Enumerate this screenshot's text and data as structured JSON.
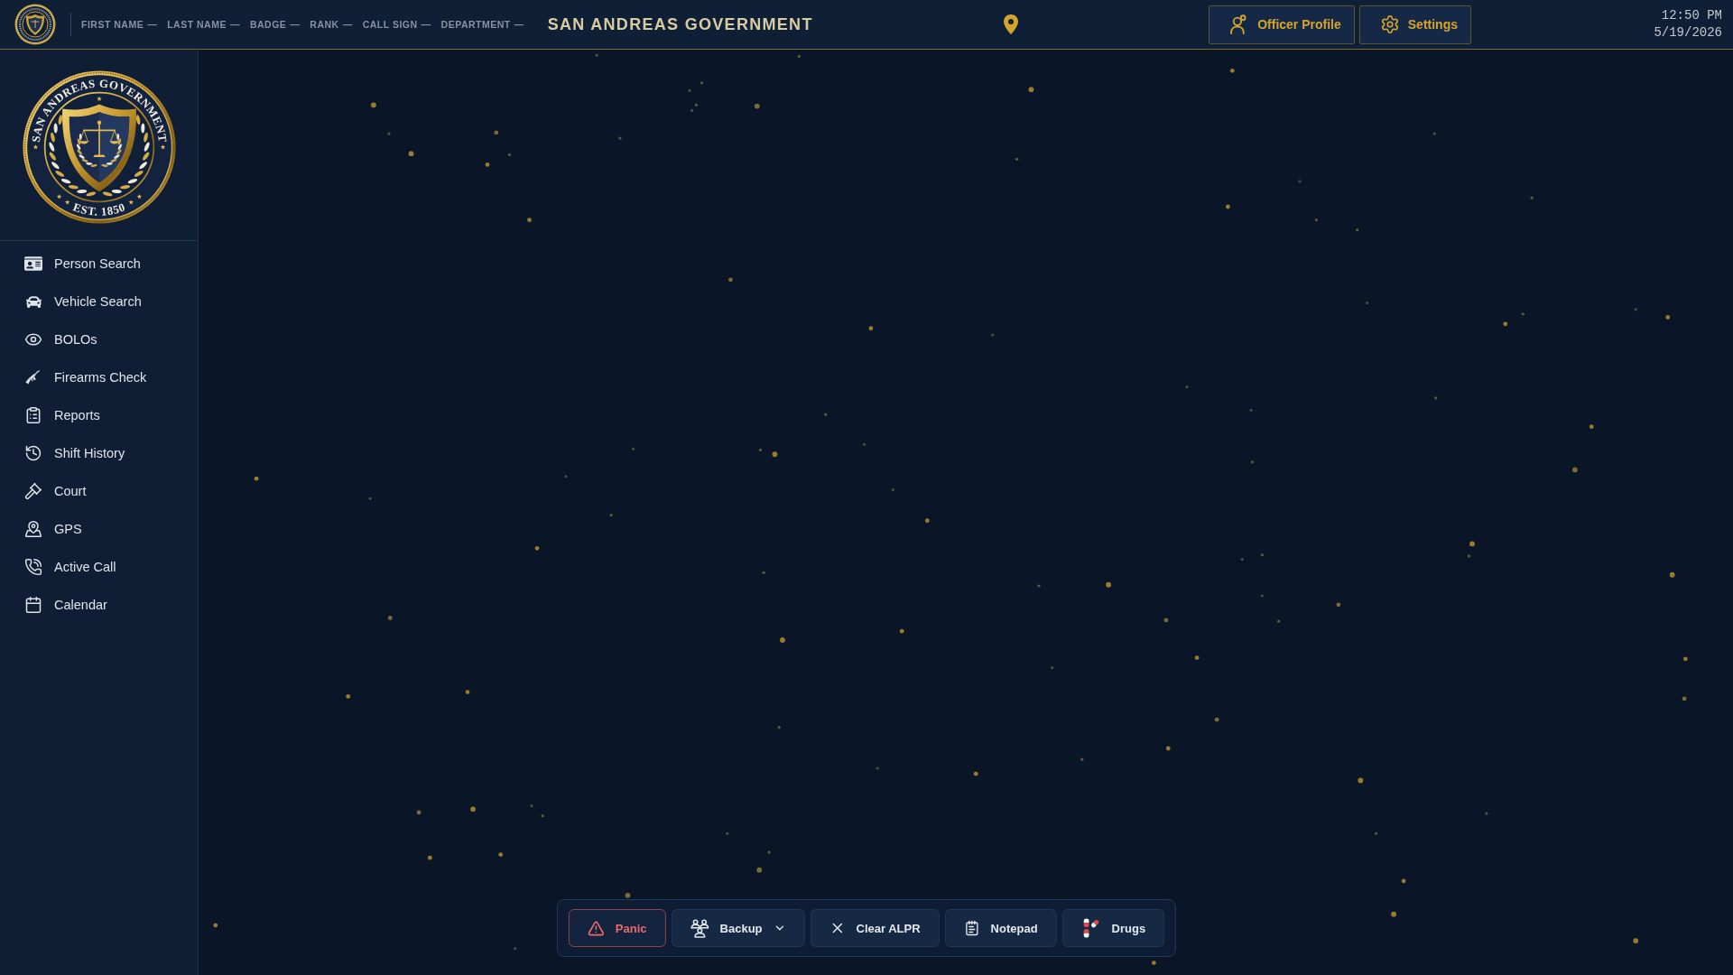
{
  "header": {
    "fields": [
      {
        "label": "FIRST NAME",
        "value": "—"
      },
      {
        "label": "LAST NAME",
        "value": "—"
      },
      {
        "label": "BADGE",
        "value": "—"
      },
      {
        "label": "RANK",
        "value": "—"
      },
      {
        "label": "CALL SIGN",
        "value": "—"
      },
      {
        "label": "DEPARTMENT",
        "value": "—"
      }
    ],
    "title": "SAN ANDREAS GOVERNMENT",
    "buttons": [
      "Officer Profile",
      "Settings"
    ],
    "time": "12:50 PM",
    "date": "5/19/2026"
  },
  "sidebar": {
    "seal": {
      "arc_text": "SAN ANDREAS GOVERNMENT",
      "year_text": "EST. 1850"
    },
    "items": [
      {
        "label": "Person Search",
        "selected": false
      },
      {
        "label": "Vehicle Search",
        "selected": false
      },
      {
        "label": "BOLOs",
        "selected": false
      },
      {
        "label": "Firearms Check",
        "selected": false
      },
      {
        "label": "Reports",
        "selected": false
      },
      {
        "label": "Shift History",
        "selected": false
      },
      {
        "label": "Court",
        "selected": false
      },
      {
        "label": "GPS",
        "selected": false
      },
      {
        "label": "Active Call",
        "selected": false
      },
      {
        "label": "Calendar",
        "selected": false
      }
    ]
  },
  "toolbar": {
    "buttons": [
      {
        "label": "Panic",
        "kind": "danger"
      },
      {
        "label": "Backup",
        "kind": "menu"
      },
      {
        "label": "Clear ALPR",
        "kind": "action"
      },
      {
        "label": "Notepad",
        "kind": "action"
      },
      {
        "label": "Drugs",
        "kind": "action"
      }
    ]
  }
}
